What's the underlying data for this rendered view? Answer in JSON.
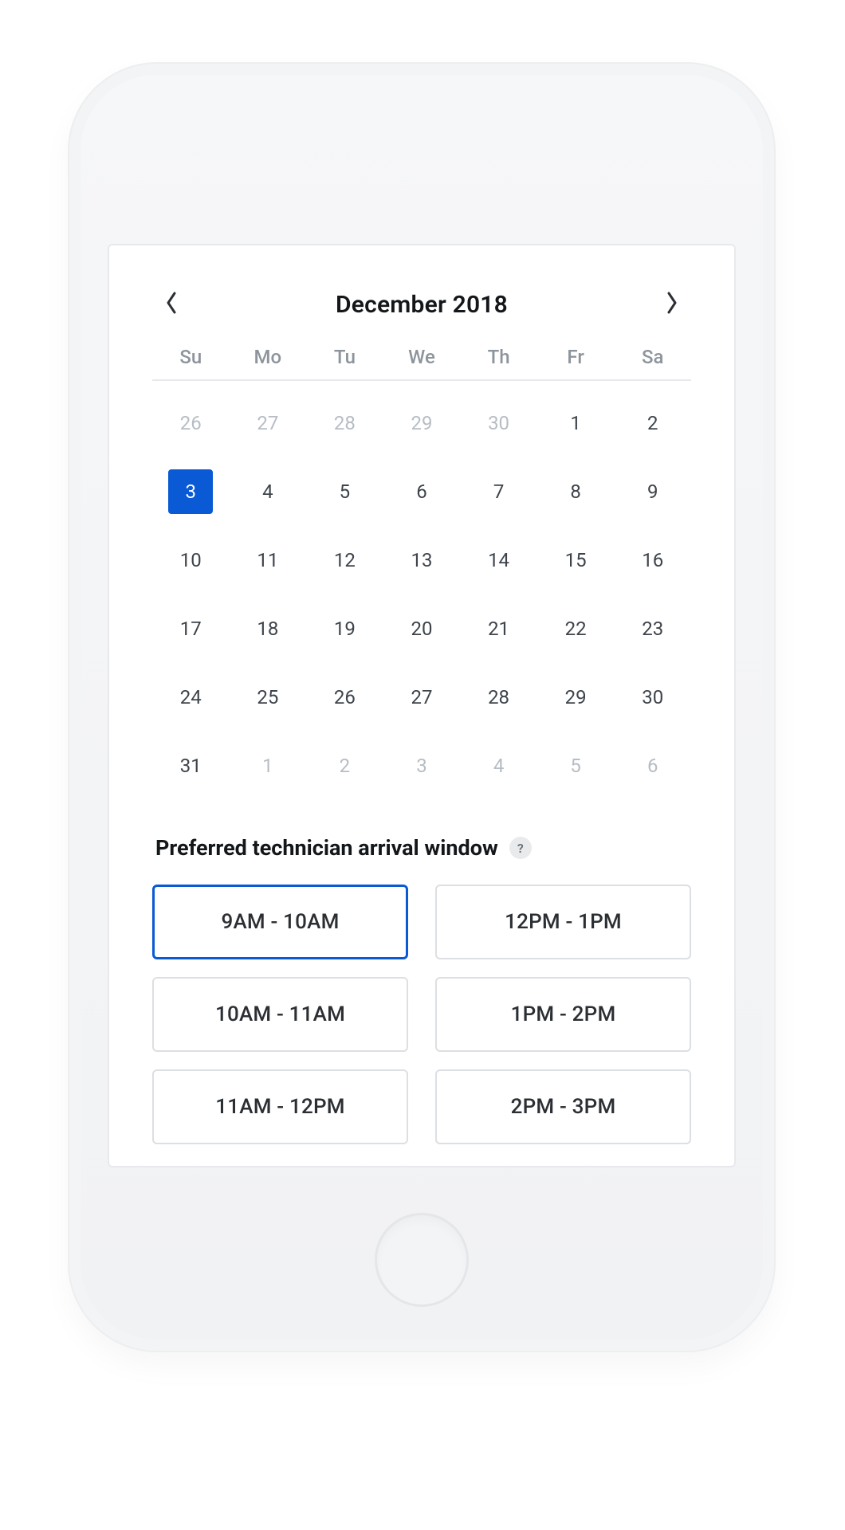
{
  "colors": {
    "accent": "#0a5ad6",
    "muted_text": "#8d949c",
    "text": "#14171a",
    "border": "#e7e9ec"
  },
  "calendar": {
    "title": "December 2018",
    "weekdays": [
      "Su",
      "Mo",
      "Tu",
      "We",
      "Th",
      "Fr",
      "Sa"
    ],
    "selected_day_index": 7,
    "days": [
      {
        "n": "26",
        "outside": true
      },
      {
        "n": "27",
        "outside": true
      },
      {
        "n": "28",
        "outside": true
      },
      {
        "n": "29",
        "outside": true
      },
      {
        "n": "30",
        "outside": true
      },
      {
        "n": "1",
        "outside": false
      },
      {
        "n": "2",
        "outside": false
      },
      {
        "n": "3",
        "outside": false
      },
      {
        "n": "4",
        "outside": false
      },
      {
        "n": "5",
        "outside": false
      },
      {
        "n": "6",
        "outside": false
      },
      {
        "n": "7",
        "outside": false
      },
      {
        "n": "8",
        "outside": false
      },
      {
        "n": "9",
        "outside": false
      },
      {
        "n": "10",
        "outside": false
      },
      {
        "n": "11",
        "outside": false
      },
      {
        "n": "12",
        "outside": false
      },
      {
        "n": "13",
        "outside": false
      },
      {
        "n": "14",
        "outside": false
      },
      {
        "n": "15",
        "outside": false
      },
      {
        "n": "16",
        "outside": false
      },
      {
        "n": "17",
        "outside": false
      },
      {
        "n": "18",
        "outside": false
      },
      {
        "n": "19",
        "outside": false
      },
      {
        "n": "20",
        "outside": false
      },
      {
        "n": "21",
        "outside": false
      },
      {
        "n": "22",
        "outside": false
      },
      {
        "n": "23",
        "outside": false
      },
      {
        "n": "24",
        "outside": false
      },
      {
        "n": "25",
        "outside": false
      },
      {
        "n": "26",
        "outside": false
      },
      {
        "n": "27",
        "outside": false
      },
      {
        "n": "28",
        "outside": false
      },
      {
        "n": "29",
        "outside": false
      },
      {
        "n": "30",
        "outside": false
      },
      {
        "n": "31",
        "outside": false
      },
      {
        "n": "1",
        "outside": true
      },
      {
        "n": "2",
        "outside": true
      },
      {
        "n": "3",
        "outside": true
      },
      {
        "n": "4",
        "outside": true
      },
      {
        "n": "5",
        "outside": true
      },
      {
        "n": "6",
        "outside": true
      }
    ]
  },
  "arrival": {
    "heading": "Preferred technician arrival window",
    "help_glyph": "?",
    "selected_index": 0,
    "slots": [
      "9AM - 10AM",
      "12PM - 1PM",
      "10AM - 11AM",
      "1PM - 2PM",
      "11AM - 12PM",
      "2PM - 3PM"
    ]
  }
}
